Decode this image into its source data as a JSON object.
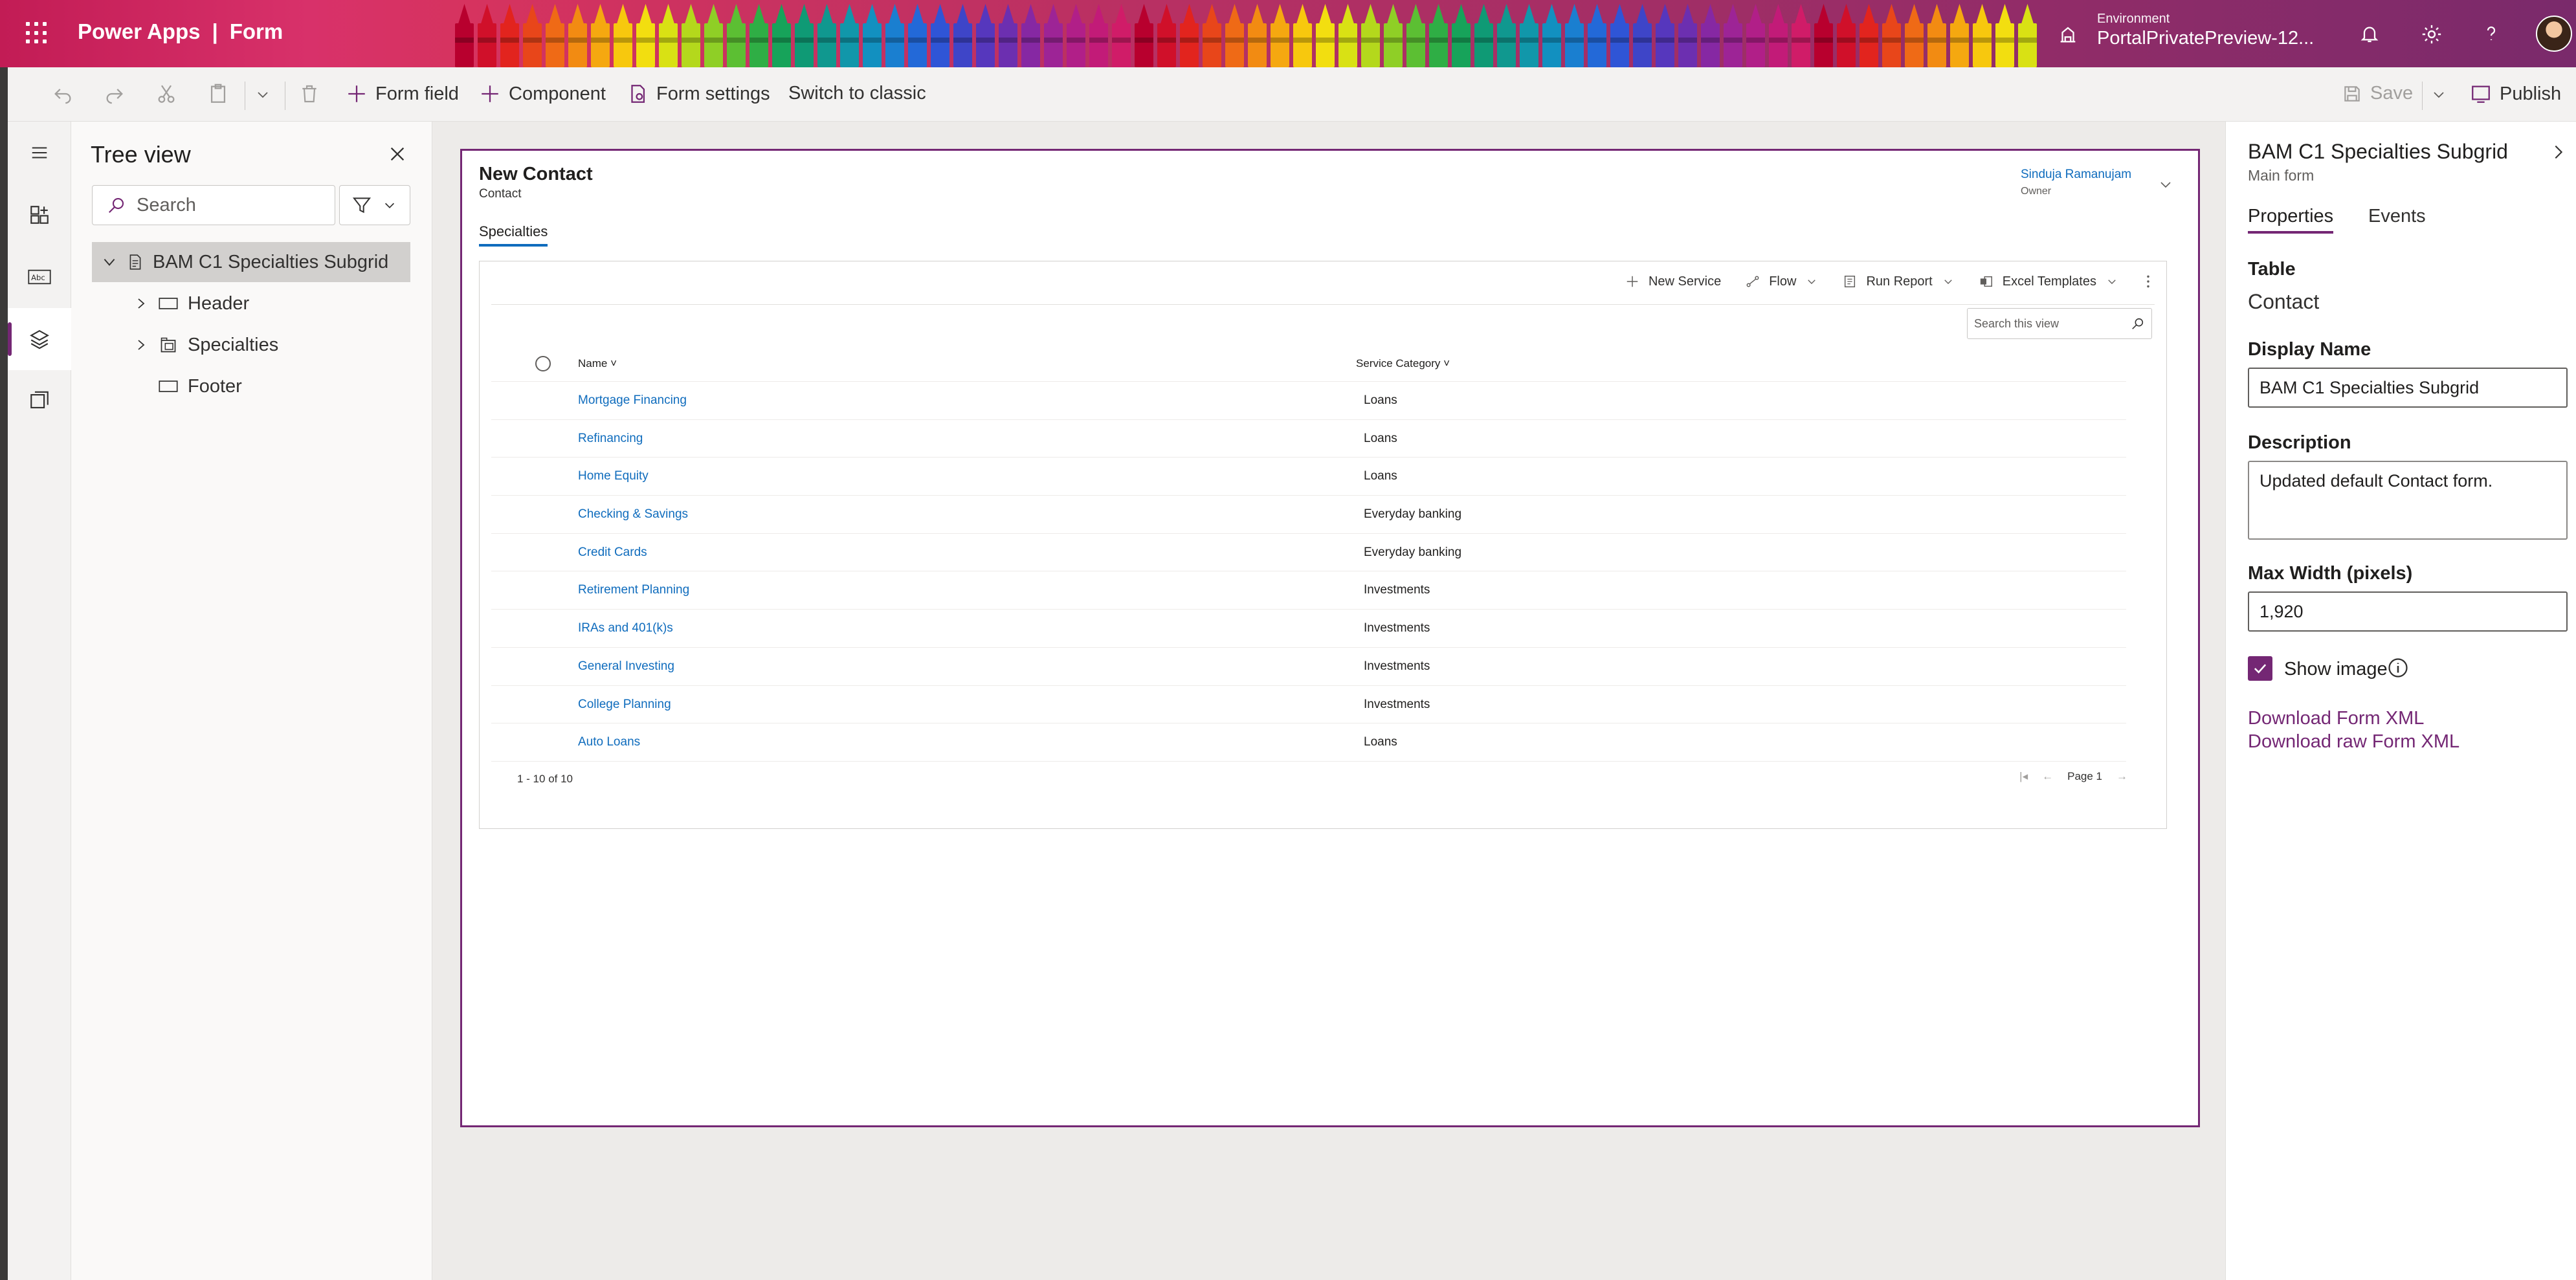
{
  "topbar": {
    "app_name": "Power Apps",
    "separator": "|",
    "section": "Form",
    "environment_label": "Environment",
    "environment_value": "PortalPrivatePreview-12...",
    "icons": [
      "waffle-icon",
      "environment-icon",
      "notification-icon",
      "settings-icon",
      "help-icon",
      "user-avatar"
    ]
  },
  "commandbar": {
    "form_field": "Form field",
    "component": "Component",
    "form_settings": "Form settings",
    "switch_classic": "Switch to classic",
    "save": "Save",
    "publish": "Publish"
  },
  "tree": {
    "title": "Tree view",
    "search_placeholder": "Search",
    "root": "BAM C1 Specialties Subgrid",
    "nodes": [
      "Header",
      "Specialties",
      "Footer"
    ]
  },
  "form": {
    "title": "New Contact",
    "entity": "Contact",
    "owner_name": "Sinduja Ramanujam",
    "owner_label": "Owner",
    "tab": "Specialties",
    "grid": {
      "commands": {
        "new_service": "New Service",
        "flow": "Flow",
        "run_report": "Run Report",
        "excel_templates": "Excel Templates"
      },
      "search_placeholder": "Search this view",
      "columns": [
        "Name",
        "Service Category"
      ],
      "rows": [
        {
          "name": "Mortgage Financing",
          "category": "Loans"
        },
        {
          "name": "Refinancing",
          "category": "Loans"
        },
        {
          "name": "Home Equity",
          "category": "Loans"
        },
        {
          "name": "Checking & Savings",
          "category": "Everyday banking"
        },
        {
          "name": "Credit Cards",
          "category": "Everyday banking"
        },
        {
          "name": "Retirement Planning",
          "category": "Investments"
        },
        {
          "name": "IRAs and 401(k)s",
          "category": "Investments"
        },
        {
          "name": "General Investing",
          "category": "Investments"
        },
        {
          "name": "College Planning",
          "category": "Investments"
        },
        {
          "name": "Auto Loans",
          "category": "Loans"
        }
      ],
      "record_count": "1 - 10 of 10",
      "page": "Page 1"
    }
  },
  "properties": {
    "title": "BAM C1 Specialties Subgrid",
    "subtitle": "Main form",
    "tabs": [
      "Properties",
      "Events"
    ],
    "table_label": "Table",
    "table_value": "Contact",
    "display_name_label": "Display Name",
    "display_name_value": "BAM C1 Specialties Subgrid",
    "description_label": "Description",
    "description_value": "Updated default Contact form.",
    "max_width_label": "Max Width (pixels)",
    "max_width_value": "1,920",
    "show_image_label": "Show image",
    "show_image_checked": true,
    "download_xml": "Download Form XML",
    "download_raw_xml": "Download raw Form XML"
  },
  "colors": {
    "accent": "#742774",
    "link": "#0f6cbd",
    "topbar": "#c21c55"
  }
}
